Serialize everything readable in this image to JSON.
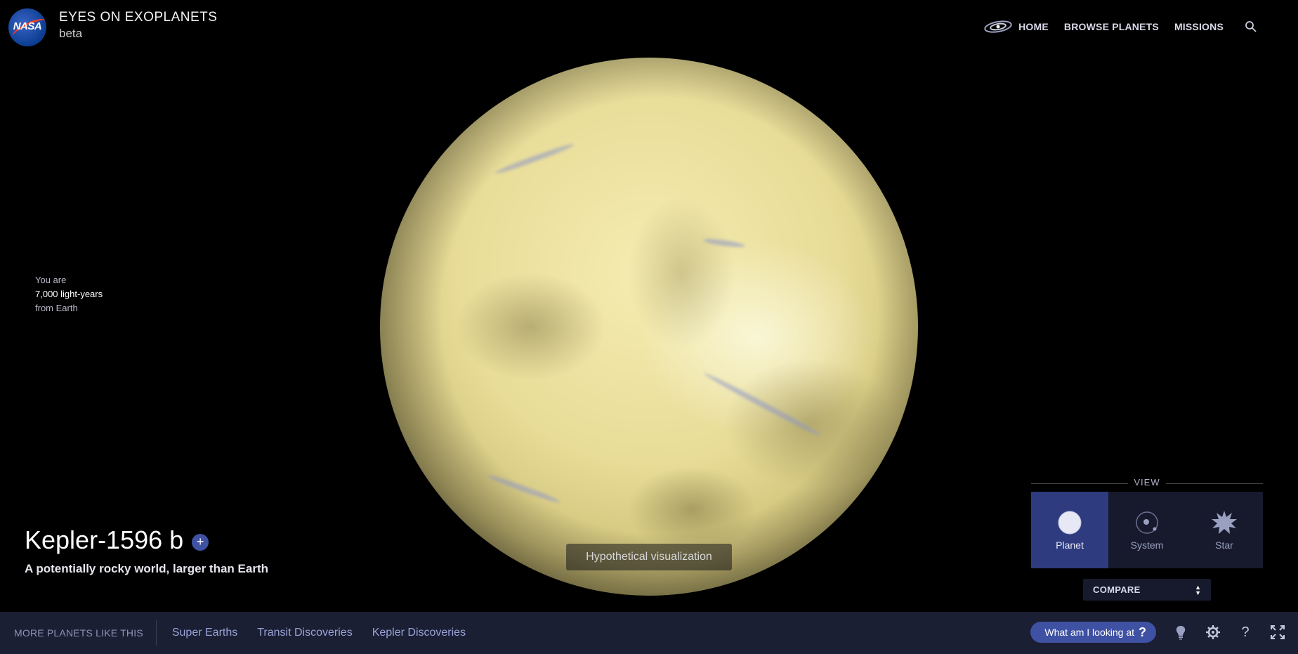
{
  "header": {
    "logo_text": "NASA",
    "title": "EYES ON EXOPLANETS",
    "subtitle": "beta",
    "nav": {
      "home": "HOME",
      "browse": "BROWSE PLANETS",
      "missions": "MISSIONS"
    }
  },
  "distance": {
    "prefix": "You are",
    "value": "7,000 light-years",
    "suffix": "from Earth"
  },
  "planet": {
    "name": "Kepler-1596 b",
    "description": "A potentially rocky world, larger than Earth",
    "add_label": "+",
    "visualization_note": "Hypothetical visualization",
    "colors": {
      "surface": "#e8dc98",
      "highlight": "#f5ecb0"
    }
  },
  "view": {
    "label": "VIEW",
    "options": [
      {
        "label": "Planet",
        "icon": "planet-icon",
        "active": true
      },
      {
        "label": "System",
        "icon": "system-icon",
        "active": false
      },
      {
        "label": "Star",
        "icon": "star-icon",
        "active": false
      }
    ],
    "compare_label": "COMPARE"
  },
  "footer": {
    "more_label": "MORE PLANETS LIKE THIS",
    "links": [
      "Super Earths",
      "Transit Discoveries",
      "Kepler Discoveries"
    ],
    "what_label": "What am I looking at",
    "what_icon": "?",
    "icons": [
      "lightbulb-icon",
      "gear-icon",
      "help-icon",
      "fullscreen-icon"
    ],
    "help_glyph": "?"
  },
  "colors": {
    "accent": "#3f51a3",
    "active_view": "#2e3b7e",
    "footer_bg": "#1b1f33"
  }
}
